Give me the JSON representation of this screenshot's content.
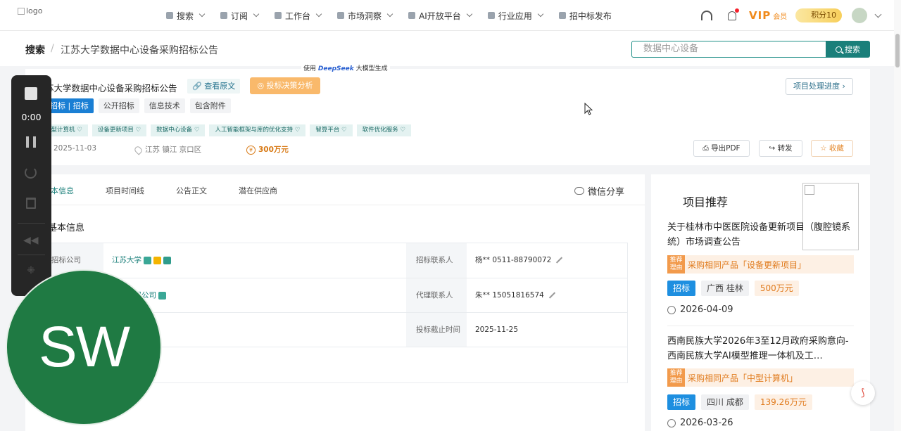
{
  "nav": {
    "logo_alt": "logo",
    "items": [
      {
        "label": "搜索",
        "icon": "search-icon"
      },
      {
        "label": "订阅",
        "icon": "bookmark-icon"
      },
      {
        "label": "工作台",
        "icon": "grid-icon"
      },
      {
        "label": "市场洞察",
        "icon": "chart-icon"
      },
      {
        "label": "AI开放平台",
        "icon": "ai-icon"
      },
      {
        "label": "行业应用",
        "icon": "bulb-icon"
      },
      {
        "label": "招中标发布",
        "icon": "send-icon"
      }
    ],
    "vip": "VIP",
    "vip_member": "会员",
    "points": "积分10"
  },
  "breadcrumb": {
    "root": "搜索",
    "separator": "/",
    "current": "江苏大学数据中心设备采购招标公告"
  },
  "search": {
    "placeholder": "数据中心设备",
    "button": "搜索"
  },
  "header": {
    "deepseek_prefix": "使用",
    "deepseek_brand": "DeepSeek",
    "deepseek_suffix": "大模型生成",
    "title": "苏大学数据中心设备采购招标公告",
    "view_original": "查看原文",
    "ai_analysis": "投标决策分析",
    "progress": "项目处理进度",
    "tags": [
      "招标 | 招标",
      "公开招标",
      "信息技术",
      "包含附件"
    ],
    "keywords": [
      "中型计算机 ♡",
      "设备更新项目 ♡",
      "数据中心设备 ♡",
      "人工智能框架与库的优化支持 ♡",
      "智算平台 ♡",
      "软件优化服务 ♡"
    ],
    "date": "2025-11-03",
    "location": "江苏 镇江 京口区",
    "amount": "300万元",
    "export_pdf": "导出PDF",
    "forward": "转发",
    "favorite": "收藏"
  },
  "tabs": [
    "本信息",
    "项目时间线",
    "公告正文",
    "潜在供应商"
  ],
  "wechat_share": "微信分享",
  "basic_info": {
    "section_title": "基本信息",
    "rows": [
      {
        "label1": "招标公司",
        "value1": "江苏大学",
        "label2": "招标联系人",
        "value2": "杨** 0511-88790072"
      },
      {
        "label1": "",
        "value1": "通信有限公司",
        "label2": "代理联系人",
        "value2": "朱** 15051816574"
      },
      {
        "label1": "",
        "value1": "",
        "label2": "投标截止时间",
        "value2": "2025-11-25"
      }
    ]
  },
  "sidebar": {
    "title": "项目推荐",
    "items": [
      {
        "title": "关于桂林市中医医院设备更新项目（腹腔镜系统）市场调查公告",
        "reason_label": "推荐理由",
        "reason": "采购相同产品「设备更新项目」",
        "type": "招标",
        "region": "广西 桂林",
        "amount": "500万元",
        "date": "2026-04-09"
      },
      {
        "title": "西南民族大学2026年3至12月政府采购意向-西南民族大学AI模型推理一体机及工…",
        "reason_label": "推荐理由",
        "reason": "采购相同产品「中型计算机」",
        "type": "招标",
        "region": "四川 成都",
        "amount": "139.26万元",
        "date": "2026-03-26"
      }
    ]
  },
  "recorder": {
    "time": "0:00",
    "avatar_initials": "SW"
  },
  "colors": {
    "brand": "#1a7f7a",
    "accent_orange": "#f9b96b",
    "tag_blue": "#1a7fd4",
    "recorder_bg": "#262626",
    "avatar_green": "#1f7a43"
  }
}
